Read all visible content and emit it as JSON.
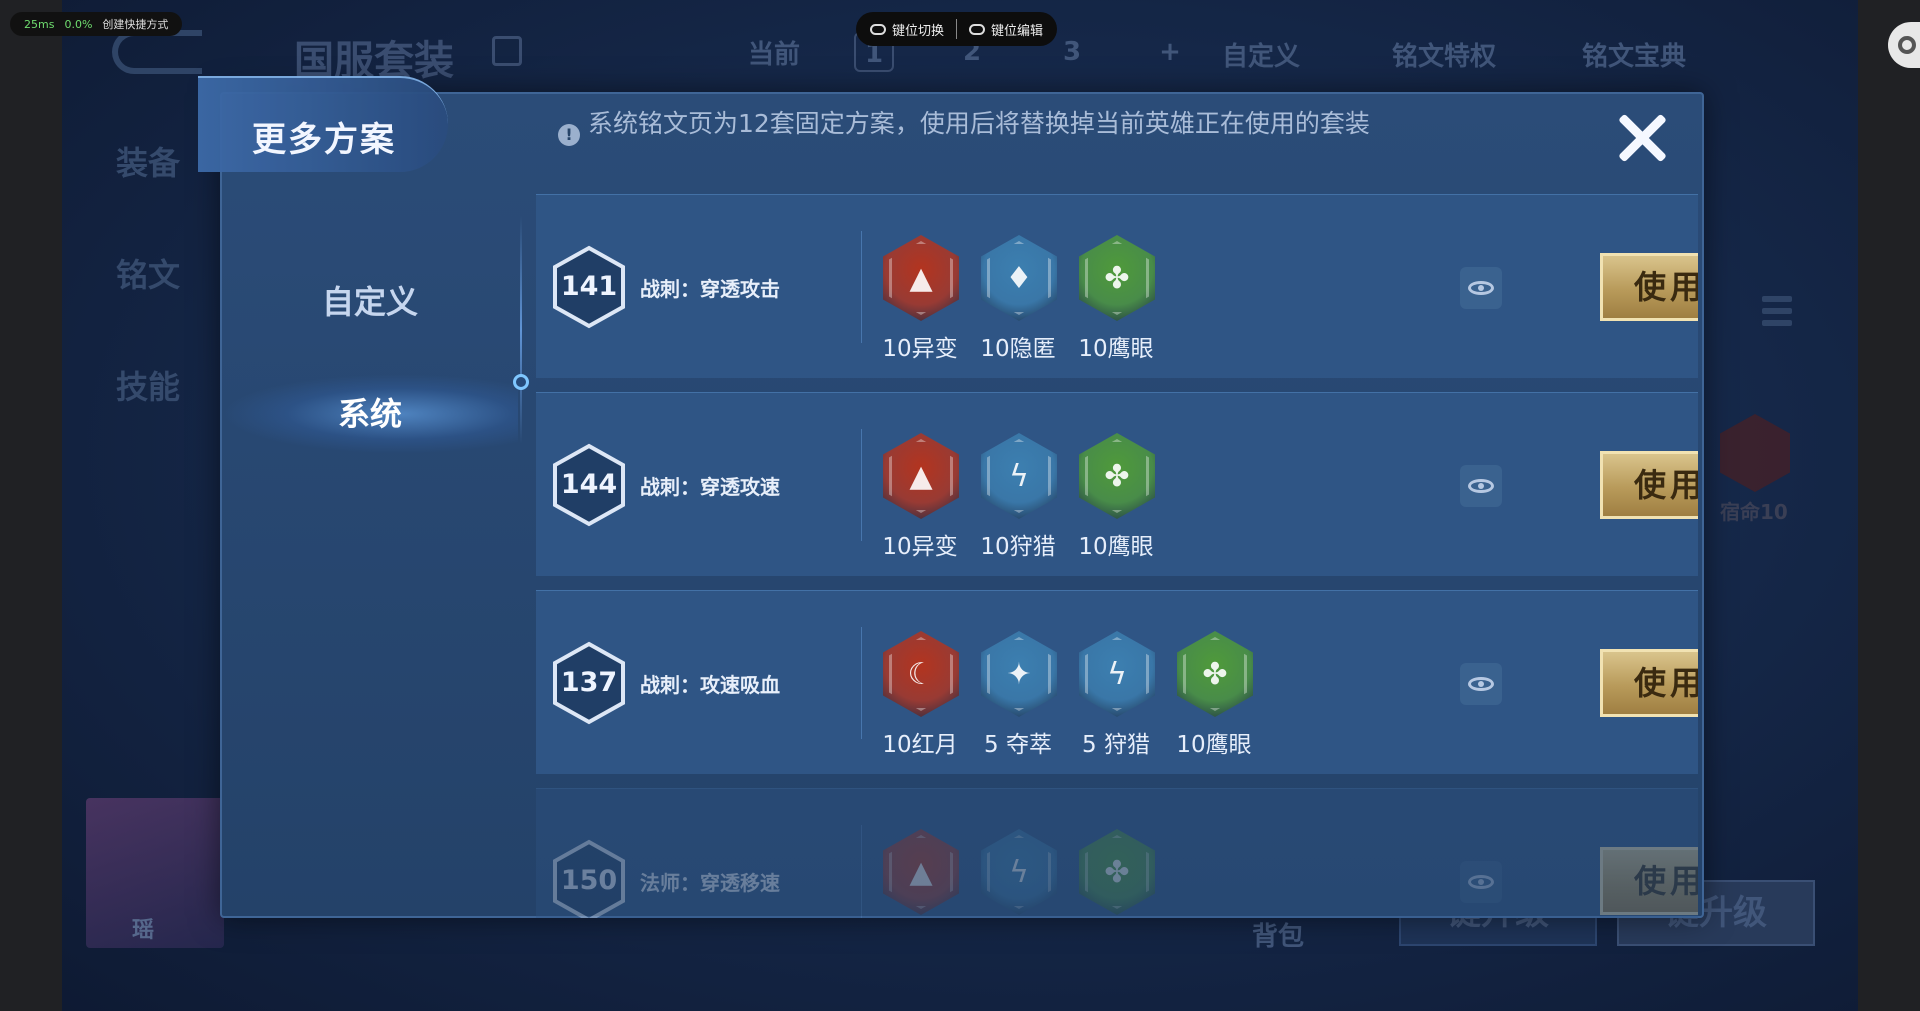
{
  "emulator": {
    "ping": "25ms",
    "loss": "0.0%",
    "shortcut_label": "创建快捷方式",
    "keybar": {
      "switch_label": "键位切换",
      "edit_label": "键位编辑"
    }
  },
  "background": {
    "title": "国服套装",
    "current_label": "当前",
    "pages": [
      "1",
      "2",
      "3",
      "+"
    ],
    "custom_label": "自定义",
    "perk_label": "铭文特权",
    "codex_label": "铭文宝典",
    "side_tabs": [
      "装备",
      "铭文",
      "技能"
    ],
    "badge_label": "宿命10",
    "hero_name": "瑶",
    "bag_label": "背包",
    "btn_upgrade_1": "键升级",
    "btn_upgrade_2": "键升级"
  },
  "modal": {
    "title": "更多方案",
    "info_text": "系统铭文页为12套固定方案，使用后将替换掉当前英雄正在使用的套装",
    "sidebar": [
      {
        "label": "自定义",
        "active": false
      },
      {
        "label": "系统",
        "active": true
      }
    ],
    "plans": [
      {
        "level": "141",
        "name": "战刺：穿透攻击",
        "use_label": "使用",
        "runes": [
          {
            "caption": "10异变",
            "color": "red",
            "glyph": "▲"
          },
          {
            "caption": "10隐匿",
            "color": "blue",
            "glyph": "♦"
          },
          {
            "caption": "10鹰眼",
            "color": "green",
            "glyph": "✤"
          }
        ]
      },
      {
        "level": "144",
        "name": "战刺：穿透攻速",
        "use_label": "使用",
        "runes": [
          {
            "caption": "10异变",
            "color": "red",
            "glyph": "▲"
          },
          {
            "caption": "10狩猎",
            "color": "blue",
            "glyph": "ϟ"
          },
          {
            "caption": "10鹰眼",
            "color": "green",
            "glyph": "✤"
          }
        ]
      },
      {
        "level": "137",
        "name": "战刺：攻速吸血",
        "use_label": "使用",
        "runes": [
          {
            "caption": "10红月",
            "color": "red",
            "glyph": "☾"
          },
          {
            "caption": "5 夺萃",
            "color": "blue",
            "glyph": "✦"
          },
          {
            "caption": "5 狩猎",
            "color": "blue",
            "glyph": "ϟ"
          },
          {
            "caption": "10鹰眼",
            "color": "green",
            "glyph": "✤"
          }
        ]
      },
      {
        "level": "150",
        "name": "法师：穿透移速",
        "use_label": "使用",
        "runes": [
          {
            "caption": "",
            "color": "red",
            "glyph": "▲"
          },
          {
            "caption": "",
            "color": "blue",
            "glyph": "ϟ"
          },
          {
            "caption": "",
            "color": "green",
            "glyph": "✤"
          }
        ]
      }
    ]
  },
  "colors": {
    "rune_red": "#b3341f",
    "rune_blue": "#3c7fb0",
    "rune_green": "#4f9a3a",
    "accent_gold": "#c9ad6a"
  }
}
